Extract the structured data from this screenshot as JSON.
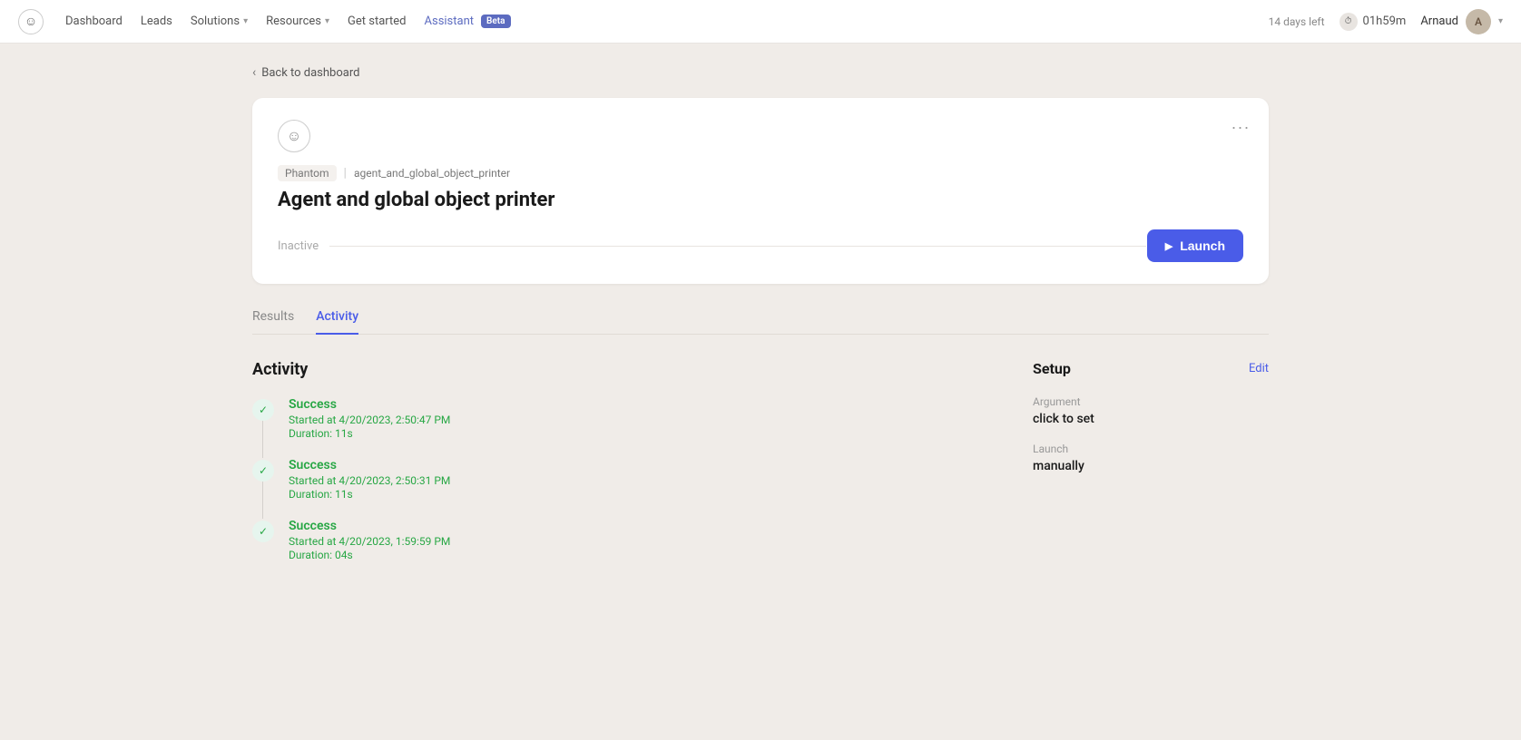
{
  "topnav": {
    "logo_symbol": "☺",
    "links": [
      {
        "label": "Dashboard",
        "active": false,
        "has_chevron": false
      },
      {
        "label": "Leads",
        "active": false,
        "has_chevron": false
      },
      {
        "label": "Solutions",
        "active": false,
        "has_chevron": true
      },
      {
        "label": "Resources",
        "active": false,
        "has_chevron": true
      },
      {
        "label": "Get started",
        "active": false,
        "has_chevron": false
      },
      {
        "label": "Assistant",
        "active": true,
        "has_chevron": false,
        "badge": "Beta"
      }
    ],
    "days_left": "14 days left",
    "timer": "01h59m",
    "user_name": "Arnaud",
    "avatar_initials": "A"
  },
  "back_link": "Back to dashboard",
  "card": {
    "phantom_label": "Phantom",
    "slug": "agent_and_global_object_printer",
    "title": "Agent and global object printer",
    "status": "Inactive",
    "launch_label": "Launch",
    "menu_icon": "..."
  },
  "tabs": [
    {
      "label": "Results",
      "active": false
    },
    {
      "label": "Activity",
      "active": true
    }
  ],
  "activity": {
    "section_title": "Activity",
    "items": [
      {
        "status": "Success",
        "started": "Started at 4/20/2023, 2:50:47 PM",
        "duration": "Duration: 11s"
      },
      {
        "status": "Success",
        "started": "Started at 4/20/2023, 2:50:31 PM",
        "duration": "Duration: 11s"
      },
      {
        "status": "Success",
        "started": "Started at 4/20/2023, 1:59:59 PM",
        "duration": "Duration: 04s"
      }
    ]
  },
  "setup": {
    "title": "Setup",
    "edit_label": "Edit",
    "argument_label": "Argument",
    "argument_value": "click to set",
    "launch_label": "Launch",
    "launch_value": "manually"
  }
}
